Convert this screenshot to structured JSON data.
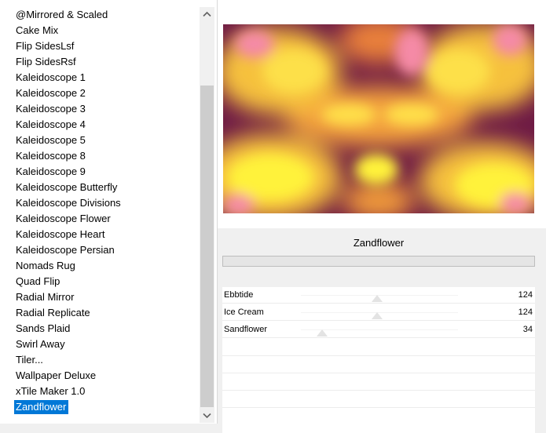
{
  "filter_list": {
    "items": [
      {
        "label": "@Mirrored & Scaled"
      },
      {
        "label": "Cake Mix"
      },
      {
        "label": "Flip SidesLsf"
      },
      {
        "label": "Flip SidesRsf"
      },
      {
        "label": "Kaleidoscope 1"
      },
      {
        "label": "Kaleidoscope 2"
      },
      {
        "label": "Kaleidoscope 3"
      },
      {
        "label": "Kaleidoscope 4"
      },
      {
        "label": "Kaleidoscope 5"
      },
      {
        "label": "Kaleidoscope 8"
      },
      {
        "label": "Kaleidoscope 9"
      },
      {
        "label": "Kaleidoscope Butterfly"
      },
      {
        "label": "Kaleidoscope Divisions"
      },
      {
        "label": "Kaleidoscope Flower"
      },
      {
        "label": "Kaleidoscope Heart"
      },
      {
        "label": "Kaleidoscope Persian"
      },
      {
        "label": "Nomads Rug"
      },
      {
        "label": "Quad Flip"
      },
      {
        "label": "Radial Mirror"
      },
      {
        "label": "Radial Replicate"
      },
      {
        "label": "Sands Plaid"
      },
      {
        "label": "Swirl Away"
      },
      {
        "label": "Tiler..."
      },
      {
        "label": "Wallpaper Deluxe"
      },
      {
        "label": "xTile Maker 1.0"
      },
      {
        "label": "Zandflower"
      }
    ],
    "selected": "Zandflower",
    "selection_color": "#0078d7"
  },
  "settings": {
    "filter_name": "Zandflower",
    "params": [
      {
        "label": "Ebbtide",
        "value": "124",
        "level": 0.486
      },
      {
        "label": "Ice Cream",
        "value": "124",
        "level": 0.486
      },
      {
        "label": "Sandflower",
        "value": "34",
        "level": 0.133
      }
    ]
  },
  "preview": {
    "colors": {
      "base": "#6e1a45",
      "yellow": "#fff23a",
      "orange": "#f4a23c",
      "pink": "#f58aa6"
    }
  },
  "icons": {
    "scroll_up": "chevron-up-icon",
    "scroll_down": "chevron-down-icon"
  }
}
